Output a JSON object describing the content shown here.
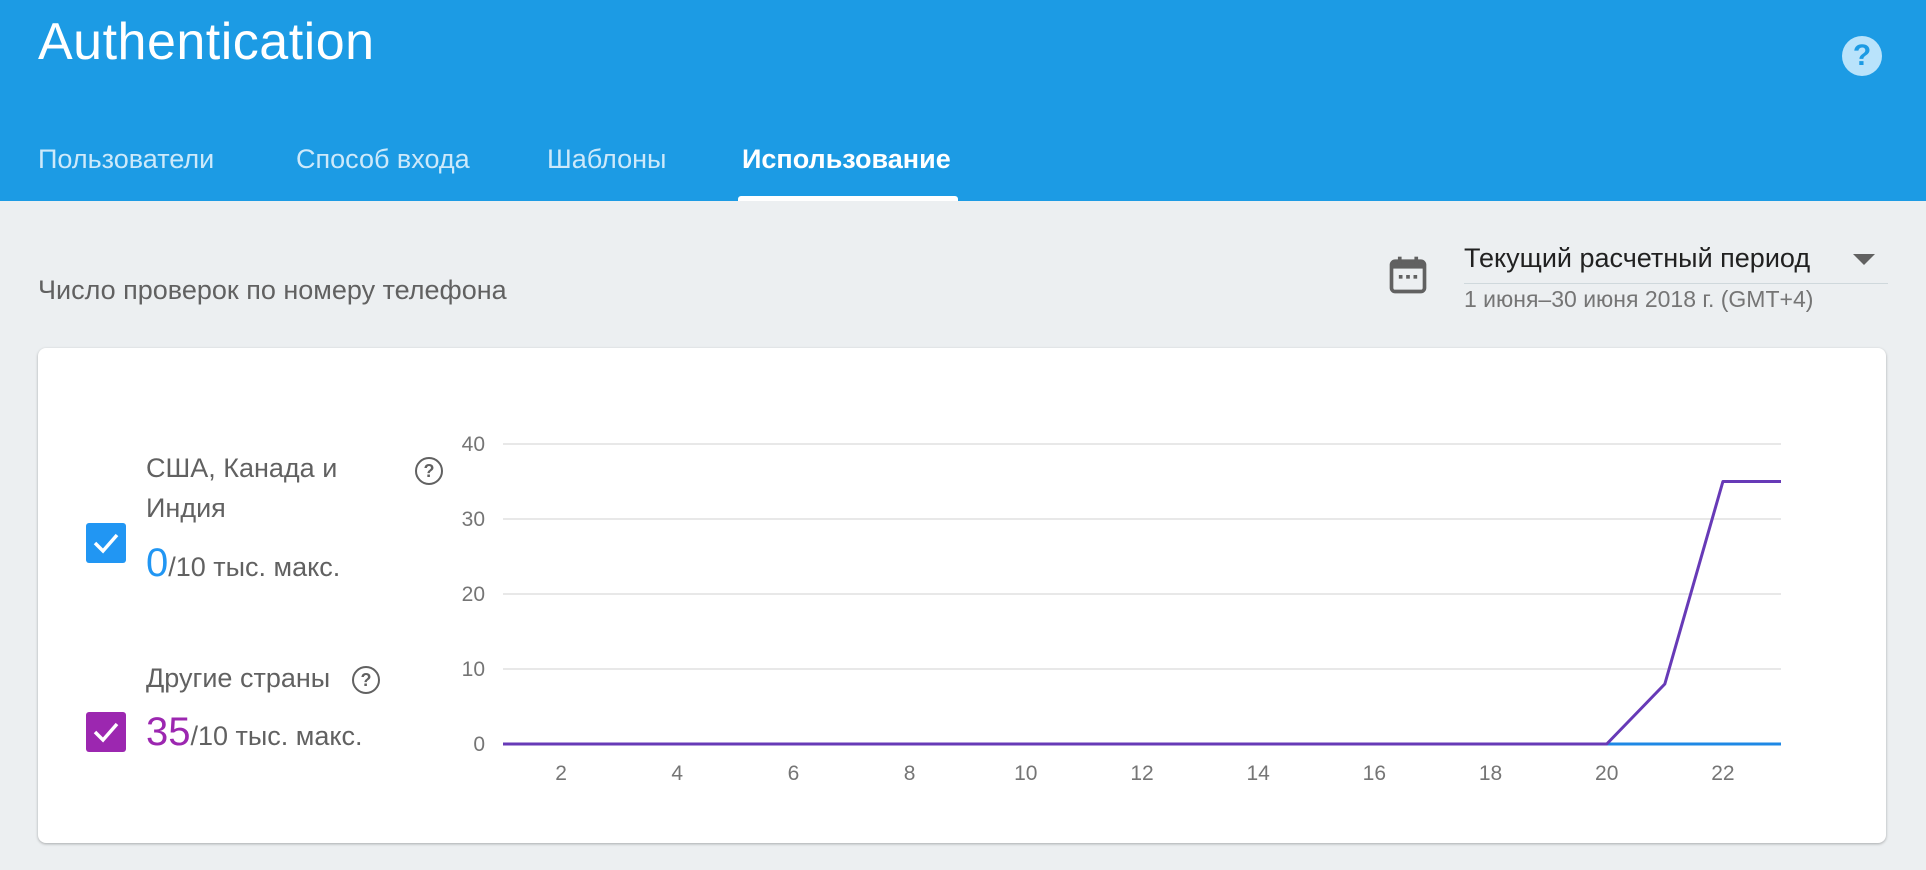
{
  "header": {
    "title": "Authentication",
    "help_icon": "help-circle-icon",
    "tabs": [
      {
        "label": "Пользователи",
        "active": false
      },
      {
        "label": "Способ входа",
        "active": false
      },
      {
        "label": "Шаблоны",
        "active": false
      },
      {
        "label": "Использование",
        "active": true
      }
    ]
  },
  "section": {
    "title": "Число проверок по номеру телефона",
    "calendar_icon": "calendar-icon",
    "period_label": "Текущий расчетный период",
    "period_range": "1 июня–30 июня 2018 г. (GMT+4)"
  },
  "legend": [
    {
      "label": "США, Канада и Индия",
      "value": "0",
      "limit": "/10 тыс. макс.",
      "color": "#2196f3",
      "checked": true
    },
    {
      "label": "Другие страны",
      "value": "35",
      "limit": "/10 тыс. макс.",
      "color": "#9c27b0",
      "checked": true
    }
  ],
  "colors": {
    "header_bg": "#1c9be4",
    "page_bg": "#eceff1",
    "series_blue": "#2196f3",
    "series_purple": "#673ab7"
  },
  "chart_data": {
    "type": "line",
    "x": [
      1,
      2,
      3,
      4,
      5,
      6,
      7,
      8,
      9,
      10,
      11,
      12,
      13,
      14,
      15,
      16,
      17,
      18,
      19,
      20,
      21,
      22,
      23
    ],
    "xticks": [
      2,
      4,
      6,
      8,
      10,
      12,
      14,
      16,
      18,
      20,
      22
    ],
    "yticks": [
      0,
      10,
      20,
      30,
      40
    ],
    "xlim": [
      1,
      23
    ],
    "ylim": [
      0,
      40
    ],
    "grid": true,
    "series": [
      {
        "name": "США, Канада и Индия",
        "color": "#1e88e5",
        "values": [
          0,
          0,
          0,
          0,
          0,
          0,
          0,
          0,
          0,
          0,
          0,
          0,
          0,
          0,
          0,
          0,
          0,
          0,
          0,
          0,
          0,
          0,
          0
        ]
      },
      {
        "name": "Другие страны",
        "color": "#673ab7",
        "values": [
          0,
          0,
          0,
          0,
          0,
          0,
          0,
          0,
          0,
          0,
          0,
          0,
          0,
          0,
          0,
          0,
          0,
          0,
          0,
          0,
          8,
          35,
          35
        ]
      }
    ]
  }
}
